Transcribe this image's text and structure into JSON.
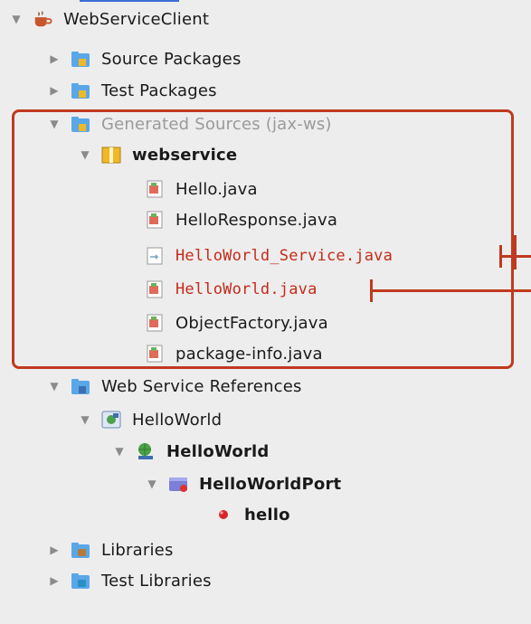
{
  "project": {
    "name": "WebServiceClient",
    "nodes": [
      {
        "label": "Source Packages"
      },
      {
        "label": "Test Packages"
      },
      {
        "label": "Generated Sources (jax-ws)"
      },
      {
        "label": "webservice"
      },
      {
        "label": "Hello.java"
      },
      {
        "label": "HelloResponse.java"
      },
      {
        "label": "HelloWorld_Service.java"
      },
      {
        "label": "HelloWorld.java"
      },
      {
        "label": "ObjectFactory.java"
      },
      {
        "label": "package-info.java"
      },
      {
        "label": "Web Service References"
      },
      {
        "label": "HelloWorld"
      },
      {
        "label": "HelloWorld"
      },
      {
        "label": "HelloWorldPort"
      },
      {
        "label": "hello"
      },
      {
        "label": "Libraries"
      },
      {
        "label": "Test Libraries"
      }
    ]
  },
  "colors": {
    "highlight": "#c03a1f",
    "highlight_text": "#c52b1a",
    "folder": "#5aa7e8",
    "package": "#f0b828"
  }
}
